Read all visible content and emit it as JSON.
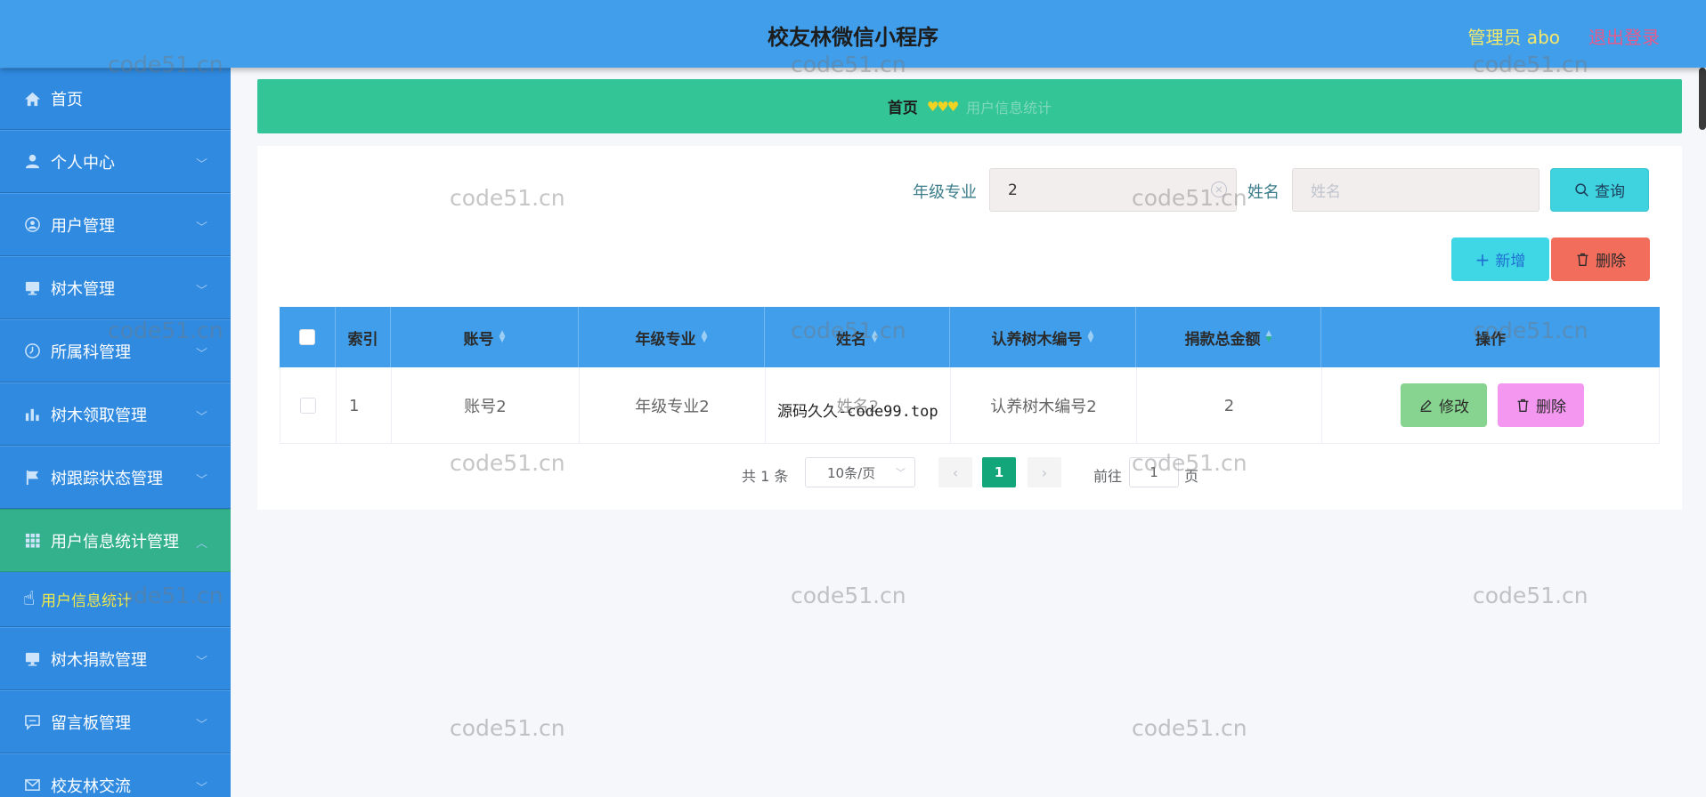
{
  "header": {
    "title": "校友林微信小程序",
    "admin": "管理员 abo",
    "logout": "退出登录"
  },
  "sidebar": {
    "items": [
      {
        "label": "首页",
        "icon": "home-icon"
      },
      {
        "label": "个人中心",
        "icon": "user-icon"
      },
      {
        "label": "用户管理",
        "icon": "circle-user-icon"
      },
      {
        "label": "树木管理",
        "icon": "monitor-icon"
      },
      {
        "label": "所属科管理",
        "icon": "clock-icon"
      },
      {
        "label": "树木领取管理",
        "icon": "bar-chart-icon"
      },
      {
        "label": "树跟踪状态管理",
        "icon": "flag-icon"
      },
      {
        "label": "用户信息统计管理",
        "icon": "grid-icon"
      },
      {
        "label": "树木捐款管理",
        "icon": "monitor-icon"
      },
      {
        "label": "留言板管理",
        "icon": "message-icon"
      },
      {
        "label": "校友林交流",
        "icon": "mail-icon"
      }
    ],
    "submenu": {
      "label": "用户信息统计"
    }
  },
  "breadcrumb": {
    "home": "首页",
    "separator": "♥♥♥",
    "current": "用户信息统计"
  },
  "search": {
    "grade_label": "年级专业",
    "grade_value": "2",
    "name_label": "姓名",
    "name_placeholder": "姓名",
    "query_button": "查询"
  },
  "actions": {
    "add": "新增",
    "delete": "删除"
  },
  "table": {
    "headers": [
      "索引",
      "账号",
      "年级专业",
      "姓名",
      "认养树木编号",
      "捐款总金额",
      "操作"
    ],
    "rows": [
      {
        "index": "1",
        "account": "账号2",
        "grade": "年级专业2",
        "name": "姓名2",
        "tree_no": "认养树木编号2",
        "amount": "2",
        "edit": "修改",
        "delete": "删除"
      }
    ]
  },
  "overlay_text": "源码久久-code99.top",
  "pagination": {
    "total": "共 1 条",
    "page_size": "10条/页",
    "current_page": "1",
    "goto_label": "前往",
    "goto_value": "1",
    "page_suffix": "页"
  },
  "watermark": "code51.cn",
  "colors": {
    "header": "#409eea",
    "sidebar": "#2f8ae0",
    "active_menu": "#33b08c",
    "breadcrumb_bar": "#33c595",
    "submenu_text": "#f2e94a"
  }
}
